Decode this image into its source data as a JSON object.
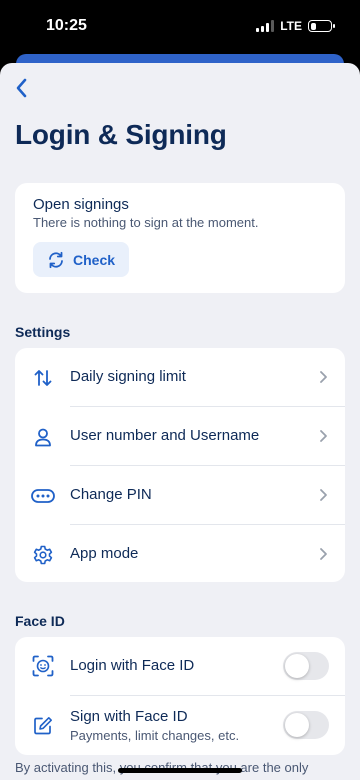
{
  "status_bar": {
    "time": "10:25",
    "network": "LTE",
    "signal_bars": 3,
    "battery_level": 0.3
  },
  "header": {
    "back_icon": "chevron-left-icon",
    "title": "Login & Signing"
  },
  "open_signings": {
    "title": "Open signings",
    "subtitle": "There is nothing to sign at the moment.",
    "check_button": {
      "label": "Check",
      "icon": "refresh-icon"
    }
  },
  "settings": {
    "section_label": "Settings",
    "items": [
      {
        "label": "Daily signing limit",
        "icon": "swap-arrows-icon"
      },
      {
        "label": "User number and Username",
        "icon": "user-icon"
      },
      {
        "label": "Change PIN",
        "icon": "pin-dots-icon"
      },
      {
        "label": "App mode",
        "icon": "gear-icon"
      }
    ]
  },
  "face_id": {
    "section_label": "Face ID",
    "items": [
      {
        "label": "Login with Face ID",
        "icon": "face-scan-icon",
        "enabled": false
      },
      {
        "label": "Sign with Face ID",
        "subtitle": "Payments, limit changes, etc.",
        "icon": "edit-icon",
        "enabled": false
      }
    ]
  },
  "footer": {
    "text": "By activating this, you confirm that you are the only"
  },
  "colors": {
    "accent": "#2061c8",
    "title": "#0e2a57",
    "background": "#eff0f5",
    "card": "#ffffff",
    "toggle_off": "#e6e7eb",
    "header_strip": "#2f63c9"
  }
}
